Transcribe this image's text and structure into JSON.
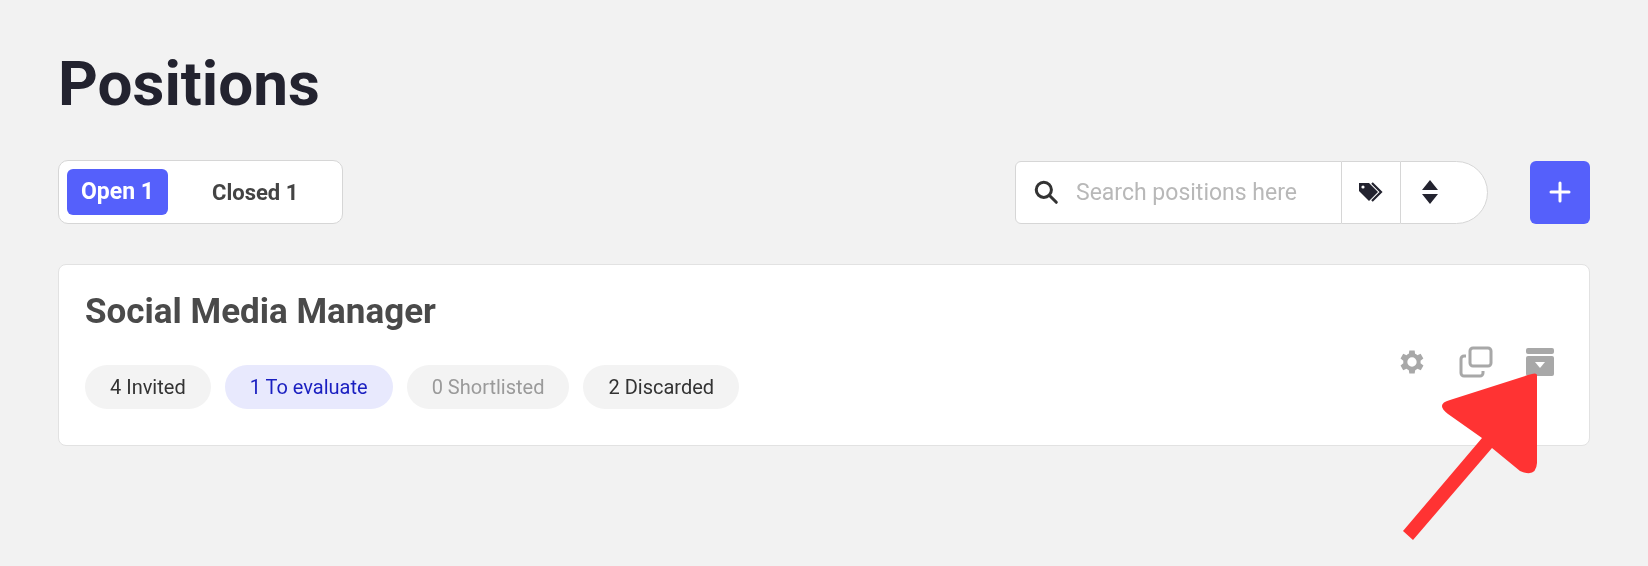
{
  "title": "Positions",
  "tabs": [
    {
      "label": "Open 1",
      "selected": true
    },
    {
      "label": "Closed 1",
      "selected": false
    }
  ],
  "search": {
    "placeholder": "Search positions here"
  },
  "positions": [
    {
      "title": "Social Media Manager",
      "stats": [
        {
          "label": "4 Invited",
          "kind": "normal"
        },
        {
          "label": "1 To evaluate",
          "kind": "highlight"
        },
        {
          "label": "0 Shortlisted",
          "kind": "muted"
        },
        {
          "label": "2 Discarded",
          "kind": "normal"
        }
      ]
    }
  ]
}
